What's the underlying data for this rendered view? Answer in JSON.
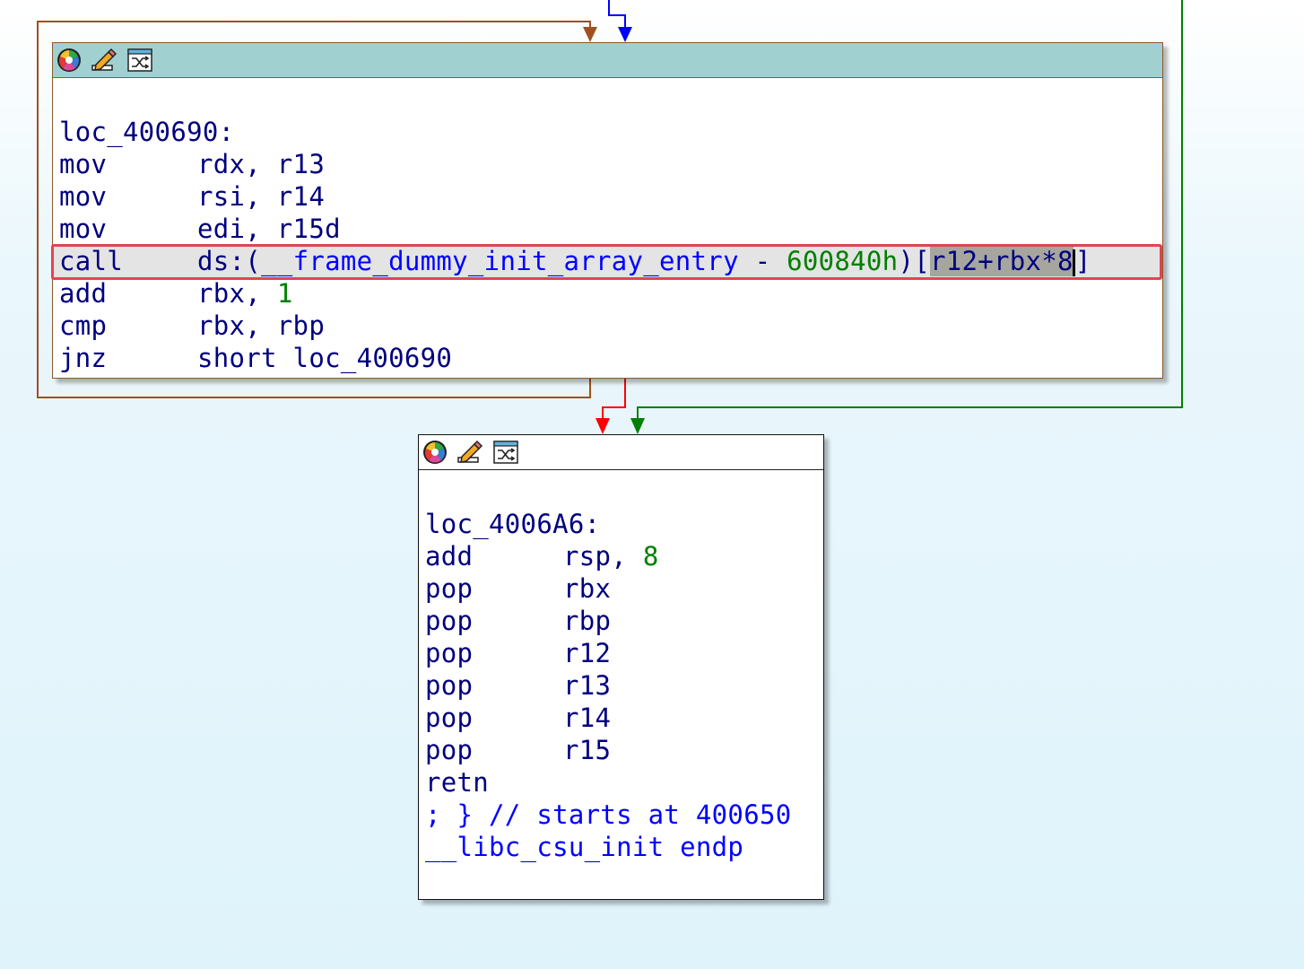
{
  "top_block": {
    "label": "loc_400690:",
    "lines": [
      {
        "mnemonic": "mov",
        "operands": "rdx, r13"
      },
      {
        "mnemonic": "mov",
        "operands": "rsi, r14"
      },
      {
        "mnemonic": "mov",
        "operands": "edi, r15d"
      }
    ],
    "selected_line": {
      "mnemonic": "call",
      "prefix": "ds:(",
      "symbol": "__frame_dummy_init_array_entry",
      "minus": " - ",
      "offset": "600840h",
      "close_paren": ")",
      "open_bracket": "[",
      "index_expr": "r12+rbx*8",
      "close_bracket": "]"
    },
    "lines_after": [
      {
        "mnemonic": "add",
        "operands": "rbx, ",
        "imm": "1"
      },
      {
        "mnemonic": "cmp",
        "operands": "rbx, rbp"
      },
      {
        "mnemonic": "jnz",
        "operands": "short loc_400690"
      }
    ]
  },
  "bottom_block": {
    "label": "loc_4006A6:",
    "lines": [
      {
        "mnemonic": "add",
        "operands": "rsp, ",
        "imm": "8"
      },
      {
        "mnemonic": "pop",
        "operands": "rbx"
      },
      {
        "mnemonic": "pop",
        "operands": "rbp"
      },
      {
        "mnemonic": "pop",
        "operands": "r12"
      },
      {
        "mnemonic": "pop",
        "operands": "r13"
      },
      {
        "mnemonic": "pop",
        "operands": "r14"
      },
      {
        "mnemonic": "pop",
        "operands": "r15"
      },
      {
        "mnemonic": "retn",
        "operands": ""
      }
    ],
    "comment": "; } // starts at 400650",
    "endp": "__libc_csu_init endp"
  },
  "header_icons": [
    "color-palette-icon",
    "rename-pencil-icon",
    "group-nodes-icon"
  ],
  "colors": {
    "edge_loop": "#a0501e",
    "edge_unconditional": "#0000ff",
    "edge_false": "#ff0000",
    "edge_true": "#008000",
    "selection_frame": "#e14450",
    "header_selected": "#a1d0d0"
  }
}
